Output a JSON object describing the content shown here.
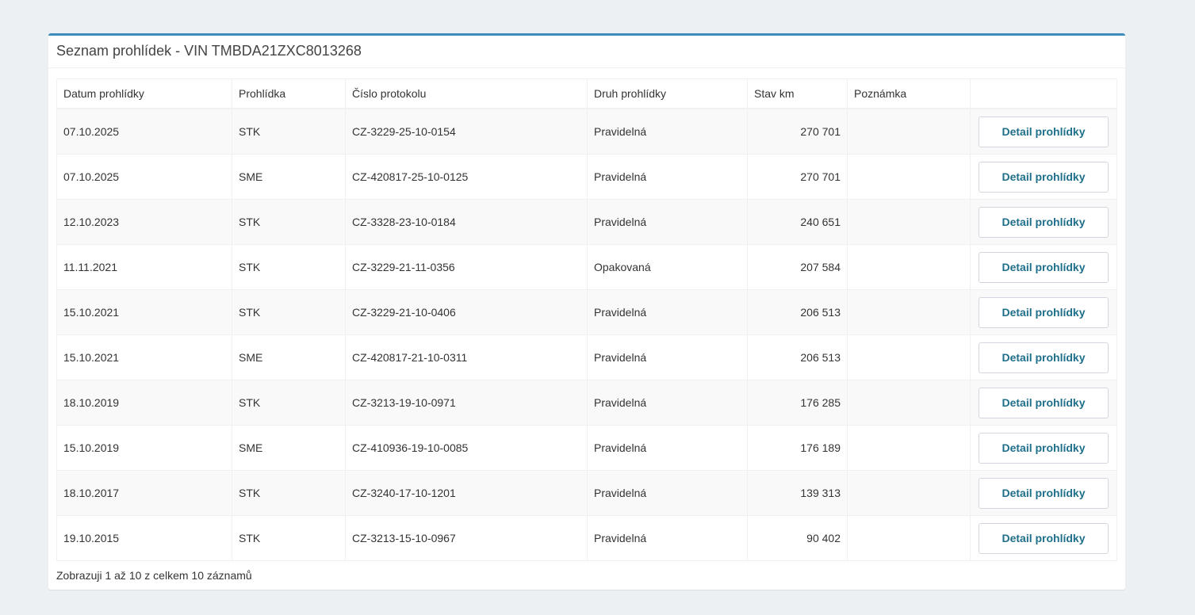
{
  "panel": {
    "title": "Seznam prohlídek - VIN TMBDA21ZXC8013268"
  },
  "table": {
    "headers": [
      "Datum prohlídky",
      "Prohlídka",
      "Číslo protokolu",
      "Druh prohlídky",
      "Stav km",
      "Poznámka",
      ""
    ],
    "rows": [
      {
        "date": "07.10.2025",
        "type": "STK",
        "protocol": "CZ-3229-25-10-0154",
        "kind": "Pravidelná",
        "km": "270 701",
        "note": "",
        "action": "Detail prohlídky"
      },
      {
        "date": "07.10.2025",
        "type": "SME",
        "protocol": "CZ-420817-25-10-0125",
        "kind": "Pravidelná",
        "km": "270 701",
        "note": "",
        "action": "Detail prohlídky"
      },
      {
        "date": "12.10.2023",
        "type": "STK",
        "protocol": "CZ-3328-23-10-0184",
        "kind": "Pravidelná",
        "km": "240 651",
        "note": "",
        "action": "Detail prohlídky"
      },
      {
        "date": "11.11.2021",
        "type": "STK",
        "protocol": "CZ-3229-21-11-0356",
        "kind": "Opakovaná",
        "km": "207 584",
        "note": "",
        "action": "Detail prohlídky"
      },
      {
        "date": "15.10.2021",
        "type": "STK",
        "protocol": "CZ-3229-21-10-0406",
        "kind": "Pravidelná",
        "km": "206 513",
        "note": "",
        "action": "Detail prohlídky"
      },
      {
        "date": "15.10.2021",
        "type": "SME",
        "protocol": "CZ-420817-21-10-0311",
        "kind": "Pravidelná",
        "km": "206 513",
        "note": "",
        "action": "Detail prohlídky"
      },
      {
        "date": "18.10.2019",
        "type": "STK",
        "protocol": "CZ-3213-19-10-0971",
        "kind": "Pravidelná",
        "km": "176 285",
        "note": "",
        "action": "Detail prohlídky"
      },
      {
        "date": "15.10.2019",
        "type": "SME",
        "protocol": "CZ-410936-19-10-0085",
        "kind": "Pravidelná",
        "km": "176 189",
        "note": "",
        "action": "Detail prohlídky"
      },
      {
        "date": "18.10.2017",
        "type": "STK",
        "protocol": "CZ-3240-17-10-1201",
        "kind": "Pravidelná",
        "km": "139 313",
        "note": "",
        "action": "Detail prohlídky"
      },
      {
        "date": "19.10.2015",
        "type": "STK",
        "protocol": "CZ-3213-15-10-0967",
        "kind": "Pravidelná",
        "km": "90 402",
        "note": "",
        "action": "Detail prohlídky"
      }
    ]
  },
  "footer": {
    "info": "Zobrazuji 1 až 10 z celkem 10 záznamů"
  },
  "colors": {
    "accent": "#3c8dbc",
    "button_text": "#1f6f8b",
    "background": "#ecf0f3"
  }
}
